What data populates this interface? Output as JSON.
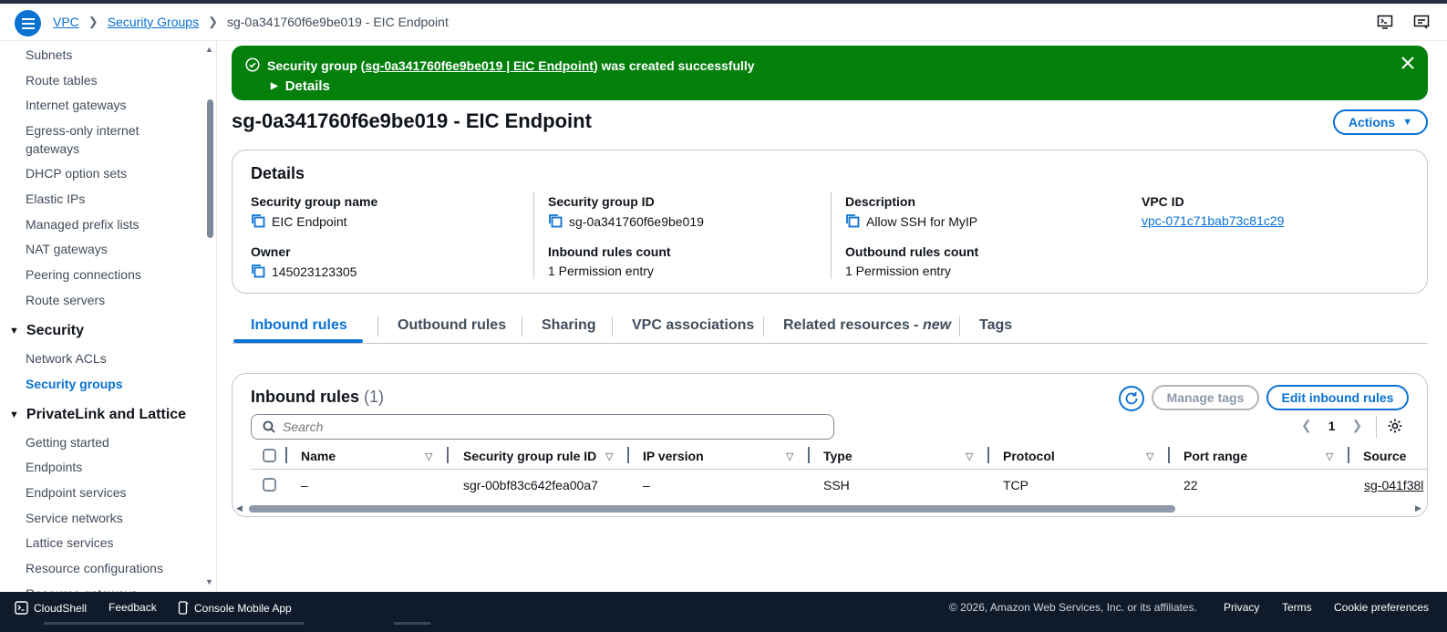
{
  "header": {
    "breadcrumbs": [
      "VPC",
      "Security Groups"
    ],
    "current": "sg-0a341760f6e9be019 - EIC Endpoint",
    "icons": [
      "cloudshell-icon",
      "support-icon"
    ]
  },
  "sidebar": {
    "items_top": [
      "Subnets",
      "Route tables",
      "Internet gateways",
      "Egress-only internet gateways",
      "DHCP option sets",
      "Elastic IPs",
      "Managed prefix lists",
      "NAT gateways",
      "Peering connections",
      "Route servers"
    ],
    "security_section": "Security",
    "security_items": [
      "Network ACLs",
      "Security groups"
    ],
    "privatelink_section": "PrivateLink and Lattice",
    "privatelink_items": [
      "Getting started",
      "Endpoints",
      "Endpoint services",
      "Service networks",
      "Lattice services",
      "Resource configurations",
      "Resource gateways"
    ]
  },
  "flash": {
    "prefix": "Security group (",
    "link": "sg-0a341760f6e9be019 | EIC Endpoint",
    "suffix": ") was created successfully",
    "details": "Details",
    "color": "#037f0c"
  },
  "page": {
    "title": "sg-0a341760f6e9be019 - EIC Endpoint",
    "actions": "Actions"
  },
  "details": {
    "heading": "Details",
    "sg_name_label": "Security group name",
    "sg_name": "EIC Endpoint",
    "sg_id_label": "Security group ID",
    "sg_id": "sg-0a341760f6e9be019",
    "desc_label": "Description",
    "desc": "Allow SSH for MyIP",
    "vpc_label": "VPC ID",
    "vpc": "vpc-071c71bab73c81c29",
    "owner_label": "Owner",
    "owner": "145023123305",
    "inbound_label": "Inbound rules count",
    "inbound": "1 Permission entry",
    "outbound_label": "Outbound rules count",
    "outbound": "1 Permission entry"
  },
  "tabs": {
    "inbound": "Inbound rules",
    "outbound": "Outbound rules",
    "sharing": "Sharing",
    "vpc_assoc": "VPC associations",
    "related": "Related resources - ",
    "related_new": "new",
    "tags": "Tags"
  },
  "rules": {
    "title": "Inbound rules",
    "count": "(1)",
    "manage_tags": "Manage tags",
    "edit": "Edit inbound rules",
    "search_placeholder": "Search",
    "page": "1",
    "columns": [
      "Name",
      "Security group rule ID",
      "IP version",
      "Type",
      "Protocol",
      "Port range",
      "Source"
    ],
    "row": {
      "name": "–",
      "rule_id": "sgr-00bf83c642fea00a7",
      "ip_version": "–",
      "type": "SSH",
      "protocol": "TCP",
      "port": "22",
      "source": "sg-041f38l"
    }
  },
  "footer": {
    "cloudshell": "CloudShell",
    "feedback": "Feedback",
    "mobile": "Console Mobile App",
    "copyright": "© 2026, Amazon Web Services, Inc. or its affiliates.",
    "privacy": "Privacy",
    "terms": "Terms",
    "cookies": "Cookie preferences"
  }
}
